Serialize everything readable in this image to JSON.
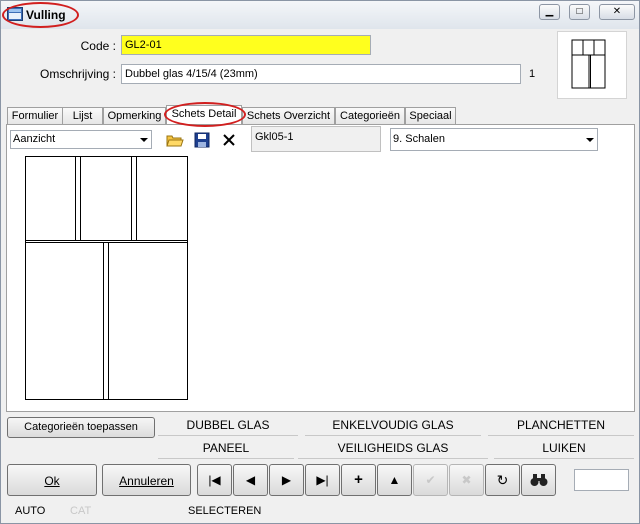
{
  "window": {
    "title": "Vulling",
    "controls": {
      "minimize": "▁",
      "maximize": "□",
      "close": "✕"
    }
  },
  "form": {
    "code_label": "Code :",
    "code_value": "GL2-01",
    "description_label": "Omschrijving :",
    "description_value": "Dubbel glas 4/15/4 (23mm)",
    "count": "1"
  },
  "tabs": [
    {
      "label": "Formulier"
    },
    {
      "label": "Lijst"
    },
    {
      "label": "Opmerking"
    },
    {
      "label": "Schets Detail",
      "active": true
    },
    {
      "label": "Schets Overzicht"
    },
    {
      "label": "Categorieën"
    },
    {
      "label": "Speciaal"
    }
  ],
  "toolbar": {
    "view_select": "Aanzicht",
    "gkl_value": "Gkl05-1",
    "scale_select": "9.  Schalen",
    "icons": [
      "open-folder-icon",
      "save-icon",
      "delete-icon"
    ]
  },
  "categories": {
    "apply_button": "Categorieën toepassen",
    "row1": [
      "DUBBEL GLAS",
      "ENKELVOUDIG GLAS",
      "PLANCHETTEN"
    ],
    "row2": [
      "PANEEL",
      "VEILIGHEIDS GLAS",
      "LUIKEN"
    ]
  },
  "buttons": {
    "ok": "Ok",
    "cancel": "Annuleren"
  },
  "nav_icons": [
    "first-record-icon",
    "previous-record-icon",
    "next-record-icon",
    "last-record-icon",
    "add-record-icon",
    "up-icon",
    "confirm-icon",
    "cancel-edit-icon",
    "refresh-icon",
    "binoculars-icon"
  ],
  "status": {
    "auto": "AUTO",
    "cat": "CAT",
    "mode": "SELECTEREN"
  },
  "colors": {
    "code_highlight": "#ffff1e",
    "annotation_red": "#d11f1f"
  }
}
